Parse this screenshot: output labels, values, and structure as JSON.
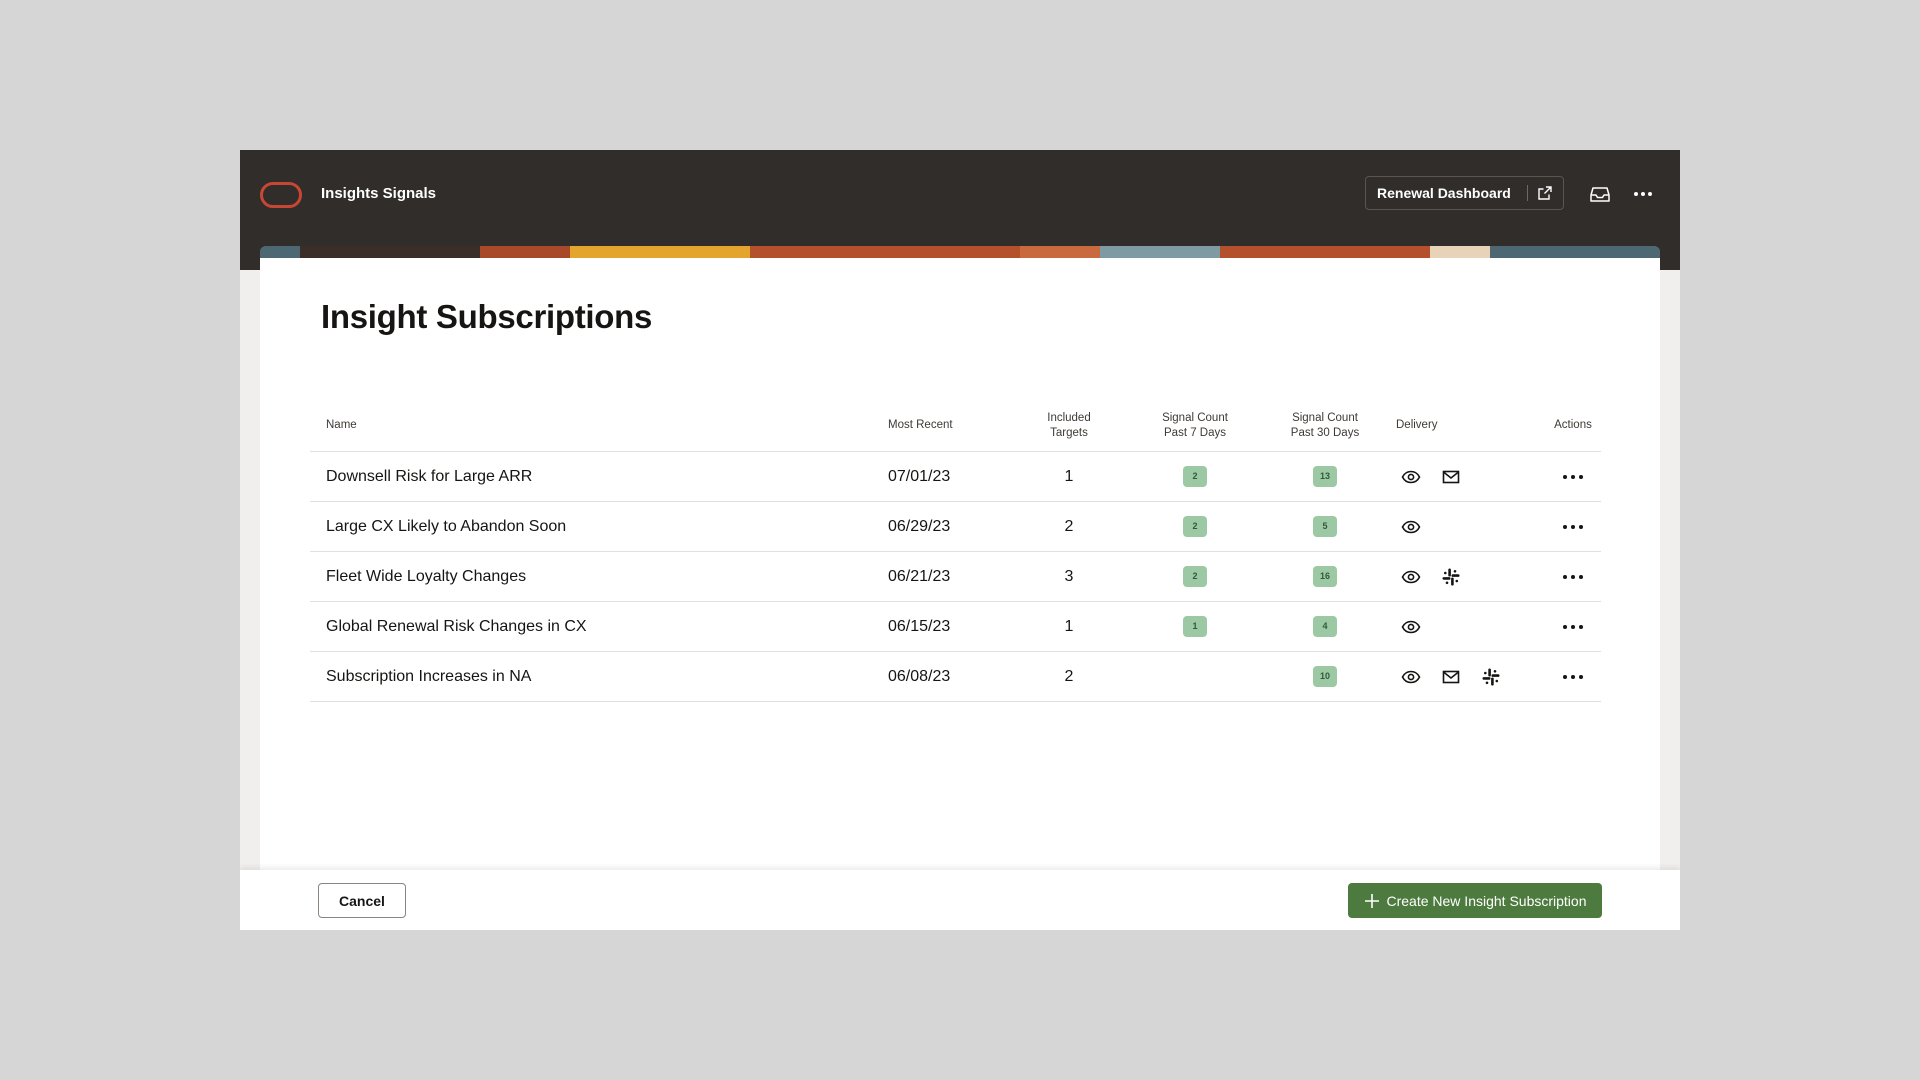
{
  "header": {
    "app_title": "Insights Signals",
    "renewal_button_label": "Renewal Dashboard"
  },
  "page": {
    "title": "Insight Subscriptions"
  },
  "table": {
    "columns": {
      "name": "Name",
      "most_recent": "Most Recent",
      "included_targets_1": "Included",
      "included_targets_2": "Targets",
      "signal7_1": "Signal Count",
      "signal7_2": "Past 7 Days",
      "signal30_1": "Signal Count",
      "signal30_2": "Past 30 Days",
      "delivery": "Delivery",
      "actions": "Actions"
    },
    "rows": [
      {
        "name": "Downsell Risk for Large ARR",
        "most_recent": "07/01/23",
        "targets": "1",
        "signal7": "2",
        "signal30": "13",
        "delivery": [
          "eye-icon",
          "mail-icon"
        ]
      },
      {
        "name": "Large CX Likely to Abandon Soon",
        "most_recent": "06/29/23",
        "targets": "2",
        "signal7": "2",
        "signal30": "5",
        "delivery": [
          "eye-icon"
        ]
      },
      {
        "name": "Fleet Wide Loyalty Changes",
        "most_recent": "06/21/23",
        "targets": "3",
        "signal7": "2",
        "signal30": "16",
        "delivery": [
          "eye-icon",
          "slack-icon"
        ]
      },
      {
        "name": "Global Renewal Risk Changes in CX",
        "most_recent": "06/15/23",
        "targets": "1",
        "signal7": "1",
        "signal30": "4",
        "delivery": [
          "eye-icon"
        ]
      },
      {
        "name": "Subscription Increases in NA",
        "most_recent": "06/08/23",
        "targets": "2",
        "signal7": "",
        "signal30": "10",
        "delivery": [
          "eye-icon",
          "mail-icon",
          "slack-icon"
        ]
      }
    ]
  },
  "footer": {
    "cancel_label": "Cancel",
    "create_label": "Create New Insight Subscription"
  },
  "colors": {
    "header_bg": "#312d2a",
    "brand": "#c74634",
    "badge_bg": "#9cc9a4",
    "primary_button": "#4d7a3e"
  }
}
